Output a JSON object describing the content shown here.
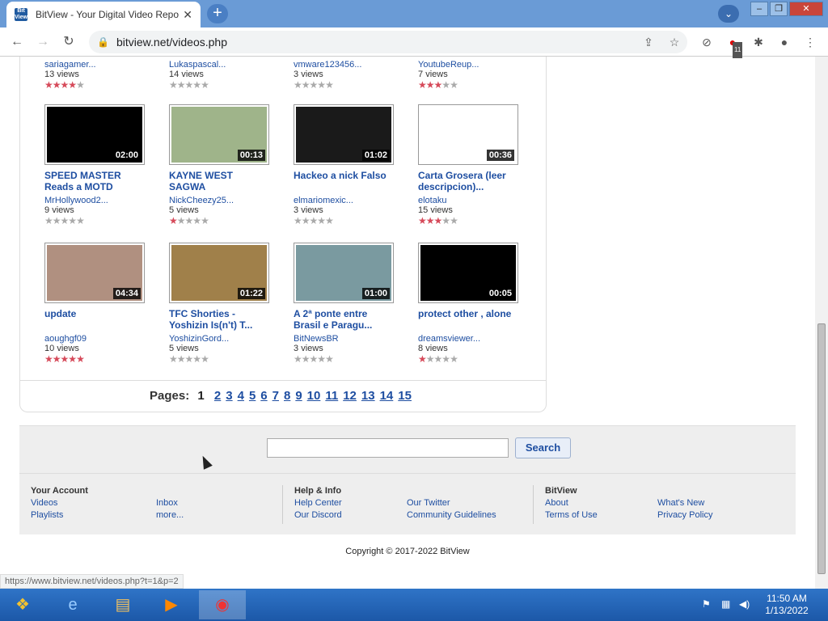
{
  "browser": {
    "tab_title": "BitView - Your Digital Video Repo",
    "favicon_text": "Bit View",
    "url": "bitview.net/videos.php",
    "ext_badge": "11"
  },
  "top_row": [
    {
      "user": "sariagamer...",
      "views_num": "13",
      "views_lbl": "views",
      "stars": 4
    },
    {
      "user": "Lukaspascal...",
      "views_num": "14",
      "views_lbl": "views",
      "stars": 0
    },
    {
      "user": "vmware123456...",
      "views_num": "3",
      "views_lbl": "views",
      "stars": 0
    },
    {
      "user": "YoutubeReup...",
      "views_num": "7",
      "views_lbl": "views",
      "stars": 3
    }
  ],
  "row2": [
    {
      "title": "SPEED MASTER Reads a MOTD",
      "duration": "02:00",
      "user": "MrHollywood2...",
      "views_num": "9",
      "views_lbl": "views",
      "stars": 0,
      "thumb_color": "#000"
    },
    {
      "title": "KAYNE WEST SAGWA",
      "duration": "00:13",
      "user": "NickCheezy25...",
      "views_num": "5",
      "views_lbl": "views",
      "stars": 1,
      "thumb_color": "#9fb48a"
    },
    {
      "title": "Hackeo a nick Falso",
      "duration": "01:02",
      "user": "elmariomexic...",
      "views_num": "3",
      "views_lbl": "views",
      "stars": 0,
      "thumb_color": "#1a1a1a"
    },
    {
      "title": "Carta Grosera (leer descripcion)...",
      "duration": "00:36",
      "user": "elotaku",
      "views_num": "15",
      "views_lbl": "views",
      "stars": 3,
      "thumb_color": "#fff"
    }
  ],
  "row3": [
    {
      "title": "update",
      "duration": "04:34",
      "user": "aoughgf09",
      "views_num": "10",
      "views_lbl": "views",
      "stars": 5,
      "thumb_color": "#b09080"
    },
    {
      "title": "TFC Shorties - Yoshizin Is(n't) T...",
      "duration": "01:22",
      "user": "YoshizinGord...",
      "views_num": "5",
      "views_lbl": "views",
      "stars": 0,
      "thumb_color": "#a0804a"
    },
    {
      "title": "A 2ª ponte entre Brasil e Paragu...",
      "duration": "01:00",
      "user": "BitNewsBR",
      "views_num": "3",
      "views_lbl": "views",
      "stars": 0,
      "thumb_color": "#7a9aa0"
    },
    {
      "title": "protect other , alone",
      "duration": "00:05",
      "user": "dreamsviewer...",
      "views_num": "8",
      "views_lbl": "views",
      "stars": 1,
      "thumb_color": "#000"
    }
  ],
  "pager": {
    "label": "Pages:",
    "current": "1",
    "pages": [
      "2",
      "3",
      "4",
      "5",
      "6",
      "7",
      "8",
      "9",
      "10",
      "11",
      "12",
      "13",
      "14",
      "15"
    ]
  },
  "footer": {
    "search_button": "Search",
    "col1": {
      "heading": "Your Account",
      "links": [
        "Videos",
        "Playlists"
      ],
      "links2": [
        "Inbox",
        "more..."
      ]
    },
    "col2": {
      "heading": "Help & Info",
      "links": [
        "Help Center",
        "Our Discord"
      ],
      "links2": [
        "Our Twitter",
        "Community Guidelines"
      ]
    },
    "col3": {
      "heading": "BitView",
      "links": [
        "About",
        "Terms of Use"
      ],
      "links2": [
        "What's New",
        "Privacy Policy"
      ]
    },
    "copyright": "Copyright © 2017-2022 BitView"
  },
  "status_url": "https://www.bitview.net/videos.php?t=1&p=2",
  "clock": {
    "time": "11:50 AM",
    "date": "1/13/2022"
  }
}
